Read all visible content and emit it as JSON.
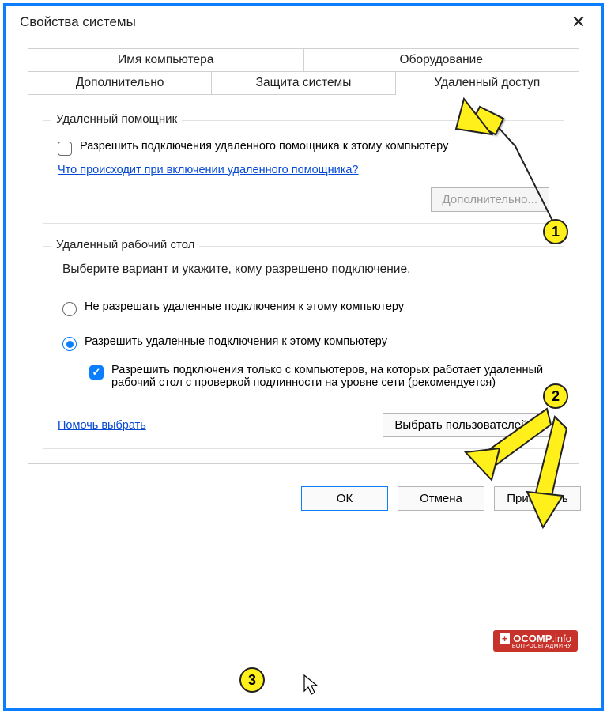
{
  "window": {
    "title": "Свойства системы"
  },
  "tabs": {
    "computer_name": "Имя компьютера",
    "hardware": "Оборудование",
    "advanced": "Дополнительно",
    "protection": "Защита системы",
    "remote": "Удаленный доступ"
  },
  "assistant": {
    "legend": "Удаленный помощник",
    "checkbox": "Разрешить подключения удаленного помощника к этому компьютеру",
    "help_link": "Что происходит при включении удаленного помощника?",
    "advanced_btn": "Дополнительно..."
  },
  "desktop": {
    "legend": "Удаленный рабочий стол",
    "desc": "Выберите вариант и укажите, кому разрешено подключение.",
    "opt_deny": "Не разрешать удаленные подключения к этому компьютеру",
    "opt_allow": "Разрешить удаленные подключения к этому компьютеру",
    "nla_checkbox": "Разрешить подключения только с компьютеров, на которых работает удаленный рабочий стол с проверкой подлинности на уровне сети (рекомендуется)",
    "help_link": "Помочь выбрать",
    "users_btn": "Выбрать пользователей..."
  },
  "buttons": {
    "ok": "ОК",
    "cancel": "Отмена",
    "apply": "Применить"
  },
  "annotations": {
    "b1": "1",
    "b2": "2",
    "b3": "3"
  },
  "watermark": {
    "brand": "OCOMP",
    "suffix": ".info",
    "tagline": "ВОПРОСЫ АДМИНУ"
  }
}
